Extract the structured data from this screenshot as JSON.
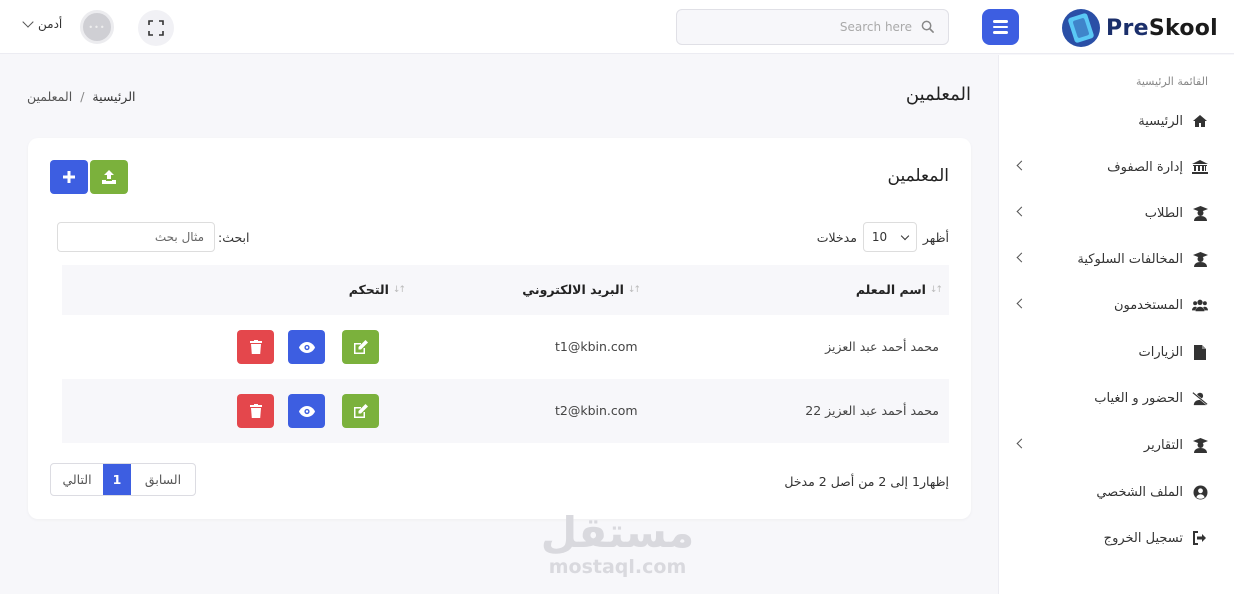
{
  "header": {
    "logo_text_pre": "Pre",
    "logo_text_rest": "Skool",
    "search_placeholder": "Search here",
    "user_name": "أدمن"
  },
  "sidebar": {
    "title": "القائمة الرئيسية",
    "items": [
      {
        "label": "الرئيسية",
        "icon": "home-icon",
        "has_arrow": false
      },
      {
        "label": "إدارة الصفوف",
        "icon": "bank-icon",
        "has_arrow": true
      },
      {
        "label": "الطلاب",
        "icon": "graduate-icon",
        "has_arrow": true
      },
      {
        "label": "المخالفات السلوكية",
        "icon": "graduate-icon",
        "has_arrow": true
      },
      {
        "label": "المستخدمون",
        "icon": "users-icon",
        "has_arrow": true
      },
      {
        "label": "الزيارات",
        "icon": "file-icon",
        "has_arrow": false
      },
      {
        "label": "الحضور و الغياب",
        "icon": "user-slash-icon",
        "has_arrow": false
      },
      {
        "label": "التقارير",
        "icon": "graduate-icon",
        "has_arrow": true
      },
      {
        "label": "الملف الشخصي",
        "icon": "user-circle-icon",
        "has_arrow": false
      },
      {
        "label": "تسجيل الخروج",
        "icon": "sign-out-icon",
        "has_arrow": false
      }
    ]
  },
  "page": {
    "title": "المعلمين",
    "breadcrumb_home": "الرئيسية",
    "breadcrumb_sep": "/",
    "breadcrumb_current": "المعلمين"
  },
  "card": {
    "title": "المعلمين",
    "show_label": "أظهر",
    "length_value": "10",
    "entries_label": "مدخلات",
    "search_label": "ابحث:",
    "search_placeholder": "مثال بحث",
    "columns": [
      "اسم المعلم",
      "البريد الالكتروني",
      "التحكم"
    ],
    "rows": [
      {
        "name": "محمد أحمد عبد العزيز",
        "email": "t1@kbin.com"
      },
      {
        "name": "محمد أحمد عبد العزيز 22",
        "email": "t2@kbin.com"
      }
    ],
    "info": "إظهار1 إلى 2 من أصل 2 مدخل",
    "pager_prev": "السابق",
    "pager_current": "1",
    "pager_next": "التالي"
  },
  "watermark": {
    "arabic": "مستقل",
    "latin": "mostaql.com"
  },
  "colors": {
    "primary": "#3d5ee1",
    "success": "#7bb13c",
    "danger": "#e4474c",
    "background": "#f7f7fa"
  }
}
